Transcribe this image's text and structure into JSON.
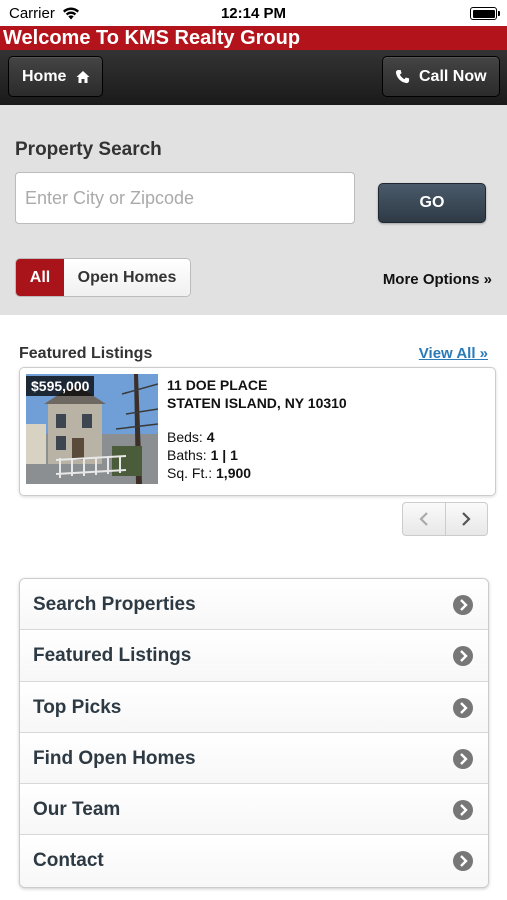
{
  "status_bar": {
    "carrier": "Carrier",
    "time": "12:14 PM"
  },
  "header": {
    "welcome": "Welcome To KMS Realty Group"
  },
  "navbar": {
    "home_label": "Home",
    "call_label": "Call Now"
  },
  "search": {
    "title": "Property Search",
    "placeholder": "Enter City or Zipcode",
    "value": "",
    "go_label": "GO",
    "filter_all": "All",
    "filter_open_homes": "Open Homes",
    "selected_filter": "All",
    "more_options": "More Options »"
  },
  "featured": {
    "title": "Featured Listings",
    "view_all": "View All »",
    "listings": [
      {
        "price": "$595,000",
        "address_line1": "11 DOE PLACE",
        "address_line2": "STATEN ISLAND, NY 10310",
        "beds_label": "Beds:",
        "beds": "4",
        "baths_label": "Baths:",
        "baths": "1 | 1",
        "sqft_label": "Sq. Ft.:",
        "sqft": "1,900"
      }
    ]
  },
  "menu": {
    "items": [
      {
        "label": "Search Properties"
      },
      {
        "label": "Featured Listings"
      },
      {
        "label": "Top Picks"
      },
      {
        "label": "Find Open Homes"
      },
      {
        "label": "Our Team"
      },
      {
        "label": "Contact"
      }
    ]
  },
  "colors": {
    "brand_red": "#b3141b",
    "nav_dark": "#222222",
    "go_button": "#3a4754",
    "link_blue": "#2a7ab8"
  },
  "icons": {
    "home": "home-icon",
    "phone": "phone-icon",
    "wifi": "wifi-icon",
    "battery": "battery-icon",
    "prev": "chevron-left-icon",
    "next": "chevron-right-icon",
    "menu_arrow": "circle-chevron-right-icon"
  }
}
